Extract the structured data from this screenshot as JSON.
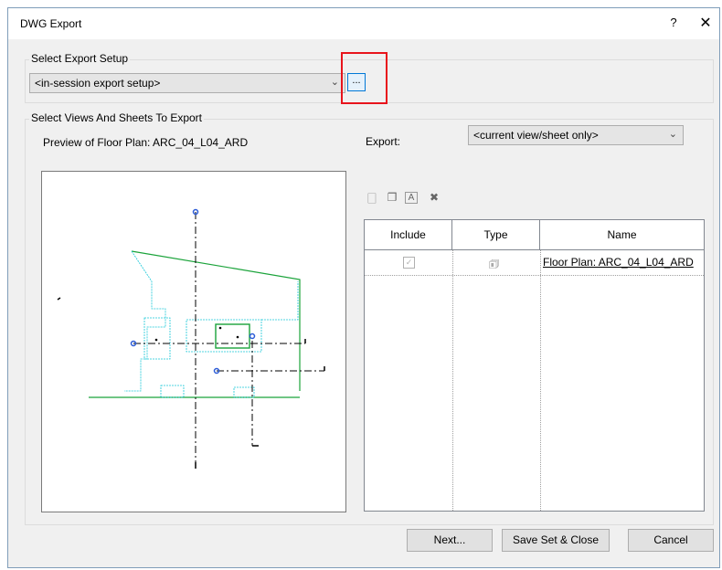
{
  "dialog": {
    "title": "DWG Export",
    "help_label": "?",
    "close_label": "✕"
  },
  "export_setup": {
    "group_label": "Select Export Setup",
    "selected_value": "<in-session export setup>",
    "ellipsis_label": "..."
  },
  "views": {
    "group_label": "Select Views And Sheets To Export",
    "preview_caption": "Preview of Floor Plan: ARC_04_L04_ARD",
    "export_label": "Export:",
    "export_value": "<current view/sheet only>"
  },
  "table": {
    "headers": [
      "Include",
      "Type",
      "Name"
    ],
    "rows": [
      {
        "include": true,
        "type_icon": "floor-plan-view-icon",
        "name": "Floor Plan: ARC_04_L04_ARD"
      }
    ]
  },
  "buttons": {
    "next": "Next...",
    "save_close": "Save Set & Close",
    "cancel": "Cancel"
  },
  "colors": {
    "highlight": "#e8141c",
    "plan_lines": "#1aa33a",
    "plan_cyan": "#17c8d8",
    "grid_marker": "#2b5bd7"
  }
}
